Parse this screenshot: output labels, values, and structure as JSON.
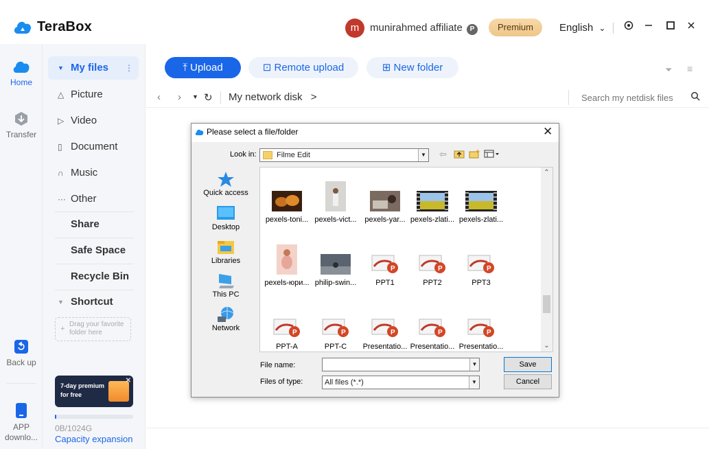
{
  "app": {
    "name": "TeraBox"
  },
  "header": {
    "avatar_letter": "m",
    "username": "munirahmed affiliate",
    "badge": "P",
    "premium_label": "Premium",
    "language": "English",
    "chevron": "⌄"
  },
  "rail": {
    "home": "Home",
    "transfer": "Transfer",
    "backup": "Back up",
    "app_download": "APP downlo..."
  },
  "sidebar": {
    "my_files": "My files",
    "picture": "Picture",
    "video": "Video",
    "document": "Document",
    "music": "Music",
    "other": "Other",
    "share": "Share",
    "safe_space": "Safe Space",
    "recycle_bin": "Recycle Bin",
    "shortcut": "Shortcut",
    "drag_hint": "Drag your favorite folder here",
    "promo_text": "7-day premium for free",
    "capacity_text": "0B/1024G",
    "capacity_link": "Capacity expansion",
    "capacity_used_fraction": 0.0
  },
  "toolbar": {
    "upload": "Upload",
    "remote_upload": "Remote upload",
    "new_folder": "New folder"
  },
  "nav": {
    "breadcrumb": "My network disk",
    "breadcrumb_arrow": ">",
    "search_placeholder": "Search my netdisk files"
  },
  "dialog": {
    "title": "Please select a file/folder",
    "look_in_label": "Look in:",
    "look_in_value": "Filme Edit",
    "places": [
      "Quick access",
      "Desktop",
      "Libraries",
      "This PC",
      "Network"
    ],
    "files": [
      {
        "name": "pexels-toni...",
        "kind": "photo-food"
      },
      {
        "name": "pexels-vict...",
        "kind": "photo-person"
      },
      {
        "name": "pexels-yar...",
        "kind": "photo-room"
      },
      {
        "name": "pexels-zlati...",
        "kind": "video-field"
      },
      {
        "name": "pexels-zlati...",
        "kind": "video-field"
      },
      {
        "name": "pexels-юри...",
        "kind": "photo-pink"
      },
      {
        "name": "philip-swin...",
        "kind": "photo-sky"
      },
      {
        "name": "PPT1",
        "kind": "ppt"
      },
      {
        "name": "PPT2",
        "kind": "ppt"
      },
      {
        "name": "PPT3",
        "kind": "ppt"
      },
      {
        "name": "PPT-A",
        "kind": "ppt"
      },
      {
        "name": "PPT-C",
        "kind": "ppt"
      },
      {
        "name": "Presentatio...",
        "kind": "ppt"
      },
      {
        "name": "Presentatio...",
        "kind": "ppt"
      },
      {
        "name": "Presentatio...",
        "kind": "ppt"
      }
    ],
    "file_name_label": "File name:",
    "file_name_value": "",
    "file_type_label": "Files of type:",
    "file_type_value": "All files (*.*)",
    "save_label": "Save",
    "cancel_label": "Cancel"
  },
  "colors": {
    "accent": "#1a66e8",
    "premium": "#eec68a",
    "avatar": "#c0392b"
  }
}
